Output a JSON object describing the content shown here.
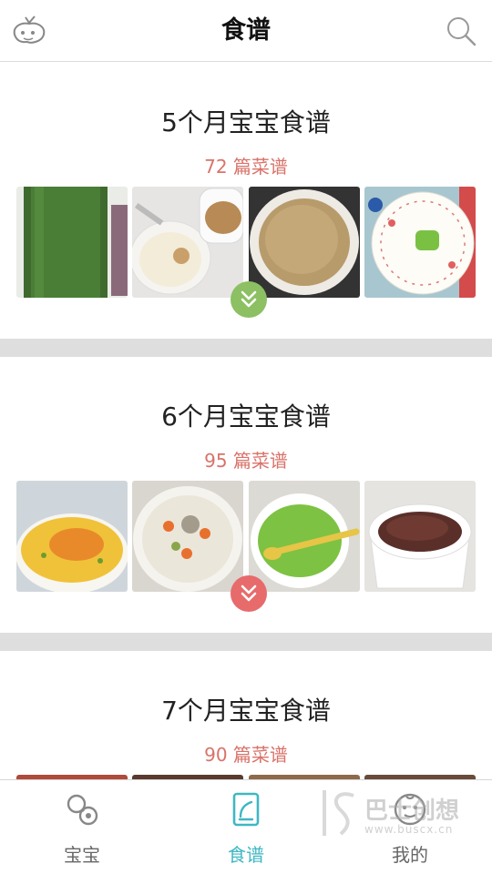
{
  "header": {
    "title": "食谱",
    "logo_icon": "baby-bean-logo-icon",
    "search_icon": "search-icon"
  },
  "sections": [
    {
      "title": "5个月宝宝食谱",
      "count": "72 篇菜谱",
      "expand_color": "#8cc063",
      "thumbs": [
        "green-juice-glass",
        "rice-porridge-bowl",
        "millet-porridge-bowl",
        "green-puree-plate"
      ]
    },
    {
      "title": "6个月宝宝食谱",
      "count": "95 篇菜谱",
      "expand_color": "#e76b6b",
      "thumbs": [
        "egg-custard-bowl",
        "carrot-porridge-bowl",
        "spinach-soup-bowl",
        "black-rice-bowl"
      ]
    },
    {
      "title": "7个月宝宝食谱",
      "count": "90 篇菜谱",
      "expand_color": "#e76b6b",
      "thumbs": []
    }
  ],
  "colors": {
    "count_text": "#d9736a",
    "active_tab": "#3fb7c3",
    "inactive_tab": "#666666",
    "divider": "#dedede"
  },
  "tabbar": {
    "tabs": [
      {
        "label": "宝宝",
        "icon": "pacifier-icon",
        "active": false
      },
      {
        "label": "食谱",
        "icon": "recipe-book-icon",
        "active": true
      },
      {
        "label": "我的",
        "icon": "baby-face-icon",
        "active": false
      }
    ]
  },
  "watermark": {
    "text": "巴士创想",
    "url": "www.buscx.cn"
  }
}
